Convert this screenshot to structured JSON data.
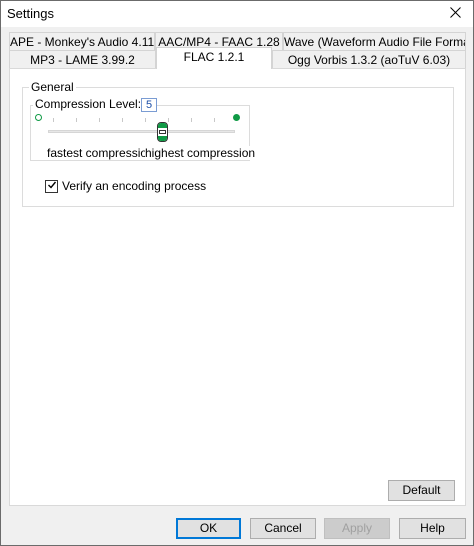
{
  "window": {
    "title": "Settings"
  },
  "tabs": {
    "row1": [
      {
        "label": "APE - Monkey's Audio 4.11"
      },
      {
        "label": "AAC/MP4 - FAAC 1.28"
      },
      {
        "label": "Wave (Waveform Audio File Format)"
      }
    ],
    "row2": [
      {
        "label": "MP3 - LAME 3.99.2"
      },
      {
        "label": "FLAC 1.2.1",
        "active": true
      },
      {
        "label": "Ogg Vorbis 1.3.2 (aoTuV 6.03)"
      }
    ]
  },
  "general": {
    "group_label": "General",
    "compression_label": "Compression Level:",
    "compression_value": "5",
    "slider": {
      "min": 0,
      "max": 8,
      "value": 5
    },
    "min_caption": "fastest compression",
    "max_caption": "highest compression",
    "verify_label": "Verify an encoding process",
    "verify_checked": true
  },
  "buttons": {
    "default": "Default",
    "ok": "OK",
    "cancel": "Cancel",
    "apply": "Apply",
    "help": "Help"
  },
  "colors": {
    "slider_accent": "#0f9a45",
    "focus_border": "#0078d7"
  }
}
